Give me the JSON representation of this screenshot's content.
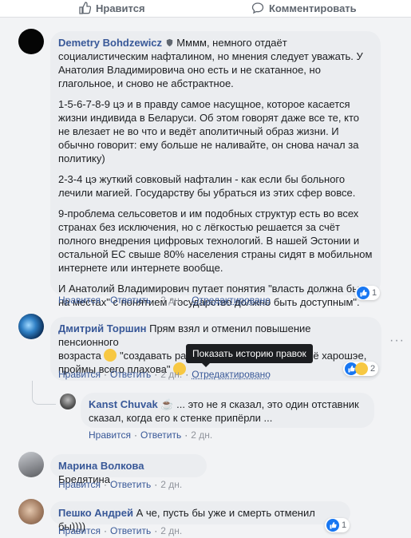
{
  "action_bar": {
    "like_label": "Нравится",
    "comment_label": "Комментировать"
  },
  "comments": [
    {
      "author": "Demetry Bohdzewicz",
      "paragraphs": [
        "Мммм, немного отдаёт социалистическим нафталином, но мнения следует уважать. У Анатолия Владимировича оно есть и не скатанное, но глагольное, и сново не абстрактное.",
        "1-5-6-7-8-9 цэ и в правду самое насущное, которое касается жизни индивида в Беларуси. Об этом говорят даже все те, кто не влезает не во что и ведёт аполитичный образ жизни. И обычно говорит: ему больше не наливайте, он снова начал за политику)",
        "2-3-4 цэ жуткий совковый нафталин - как если бы больного лечили магией. Государству бы убраться из этих сфер вовсе.",
        "9-проблема сельсоветов и им подобных структур есть во всех странах без исключения, но с лёгкостью решается за счёт полного внедрения цифровых технологий. В нашей Эстонии и остальной ЕС свыше 80% населения страны сидят в мобильном интернете или интернете вообще.",
        "И Анатолий Владимирович путает понятия \"власть должна быть на местах\" с понятием \"государство должно быть доступным\"."
      ],
      "like": "Нравится",
      "reply": "Ответить",
      "time": "2 дн.",
      "edited": "Отредактировано",
      "reaction_count": "1"
    },
    {
      "author": "Дмитрий Торшин",
      "text_line1": "Прям взял и отменил повышение пенсионного",
      "text_line2a": "возраста",
      "text_line2b": "\"создавать рабочие места\"",
      "text_line2c": "\" За всё харошэе,",
      "text_line3": "проймы всего плахова\"",
      "like": "Нравится",
      "reply": "Ответить",
      "time": "2 дн.",
      "edited": "Отредактировано",
      "reaction_count": "2",
      "tooltip": "Показать историю правок"
    },
    {
      "author": "Kanst Chuvak",
      "text_line1": "... это не я сказал, это один отставник",
      "text_line2": "сказал, когда его к стенке припёрли ...",
      "like": "Нравится",
      "reply": "Ответить",
      "time": "2 дн."
    },
    {
      "author": "Марина Волкова",
      "text": "Бредятина",
      "like": "Нравится",
      "reply": "Ответить",
      "time": "2 дн."
    },
    {
      "author": "Пешко Андрей",
      "text": "А че, пусть бы уже и смерть отменил бы))))",
      "like": "Нравится",
      "reply": "Ответить",
      "time": "2 дн.",
      "reaction_count": "1"
    }
  ],
  "colors": {
    "link": "#385898",
    "bubble": "#ebedf0",
    "like_blue": "#1877f2",
    "background": "#f2f3f5"
  }
}
